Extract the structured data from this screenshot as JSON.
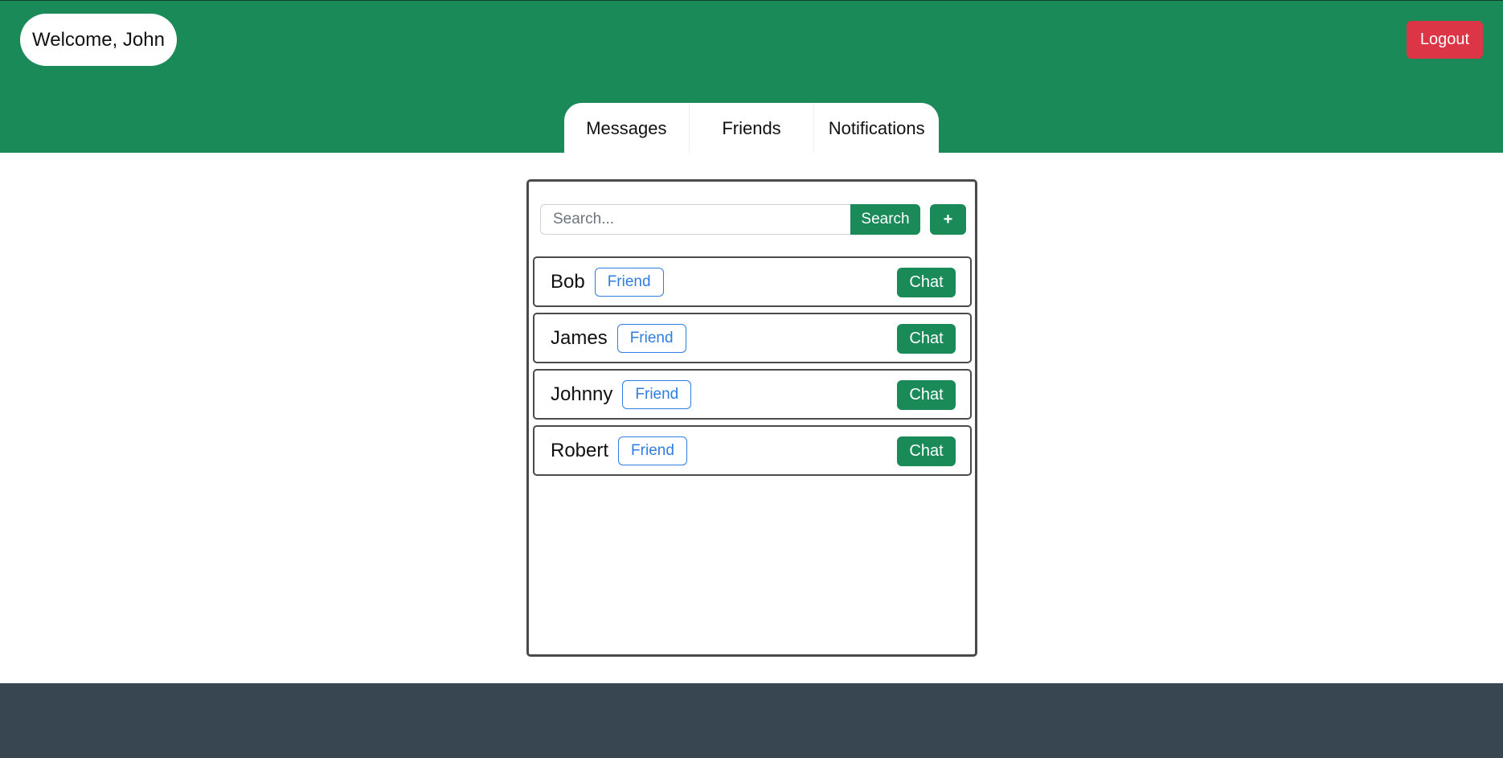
{
  "colors": {
    "header_bg": "#1a8a58",
    "primary_button": "#1a8a58",
    "logout_button": "#dc3545",
    "badge": "#2f7de1",
    "footer_bg": "#374651"
  },
  "header": {
    "welcome_text": "Welcome, John",
    "logout_label": "Logout"
  },
  "tabs": [
    {
      "label": "Messages"
    },
    {
      "label": "Friends"
    },
    {
      "label": "Notifications"
    }
  ],
  "search": {
    "placeholder": "Search...",
    "value": "",
    "button_label": "Search",
    "add_label": "+"
  },
  "friends": [
    {
      "name": "Bob",
      "badge": "Friend",
      "action": "Chat"
    },
    {
      "name": "James",
      "badge": "Friend",
      "action": "Chat"
    },
    {
      "name": "Johnny",
      "badge": "Friend",
      "action": "Chat"
    },
    {
      "name": "Robert",
      "badge": "Friend",
      "action": "Chat"
    }
  ]
}
